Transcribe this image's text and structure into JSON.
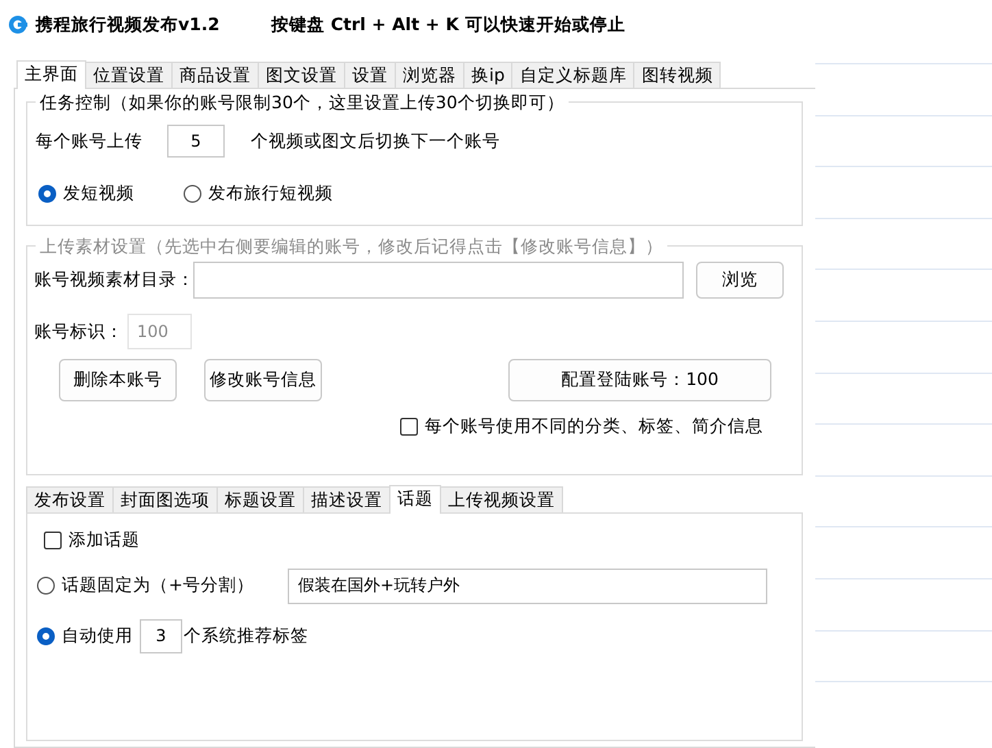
{
  "window": {
    "title": "携程旅行视频发布v1.2",
    "hint": "按键盘 Ctrl + Alt + K  可以快速开始或停止"
  },
  "tabs": [
    {
      "label": "主界面",
      "selected": true
    },
    {
      "label": "位置设置",
      "selected": false
    },
    {
      "label": "商品设置",
      "selected": false
    },
    {
      "label": "图文设置",
      "selected": false
    },
    {
      "label": "设置",
      "selected": false
    },
    {
      "label": "浏览器",
      "selected": false
    },
    {
      "label": "换ip",
      "selected": false
    },
    {
      "label": "自定义标题库",
      "selected": false
    },
    {
      "label": "图转视频",
      "selected": false
    }
  ],
  "task_group": {
    "title": "任务控制（如果你的账号限制30个，这里设置上传30个切换即可）",
    "upload_label": "每个账号上传",
    "upload_count": "5",
    "upload_suffix": "个视频或图文后切换下一个账号",
    "modes": [
      {
        "label": "发短视频",
        "selected": true
      },
      {
        "label": "发布旅行短视频",
        "selected": false
      }
    ]
  },
  "material_group": {
    "title": "上传素材设置（先选中右侧要编辑的账号，修改后记得点击【修改账号信息】）",
    "dir_label": "账号视频素材目录：",
    "browse_button": "浏览",
    "id_label": "账号标识：",
    "id_field": {
      "value": "100",
      "disabled": true
    },
    "buttons": [
      "删除本账号",
      "修改账号信息"
    ],
    "config_button": "配置登陆账号：100",
    "different_info": {
      "label": "每个账号使用不同的分类、标签、简介信息",
      "checked": false
    }
  },
  "sub_tabs": [
    {
      "label": "发布设置",
      "selected": false
    },
    {
      "label": "封面图选项",
      "selected": false
    },
    {
      "label": "标题设置",
      "selected": false
    },
    {
      "label": "描述设置",
      "selected": false
    },
    {
      "label": "话题",
      "selected": true
    },
    {
      "label": "上传视频设置",
      "selected": false
    }
  ],
  "topic": {
    "add_topic": {
      "label": "添加话题",
      "checked": false
    },
    "options": [
      {
        "kind": "fixed",
        "label": "话题固定为（+号分割）",
        "value": "假装在国外+玩转户外",
        "selected": false
      },
      {
        "kind": "auto",
        "label": "自动使用",
        "count": "3",
        "suffix": "个系统推荐标签",
        "selected": true
      }
    ]
  }
}
